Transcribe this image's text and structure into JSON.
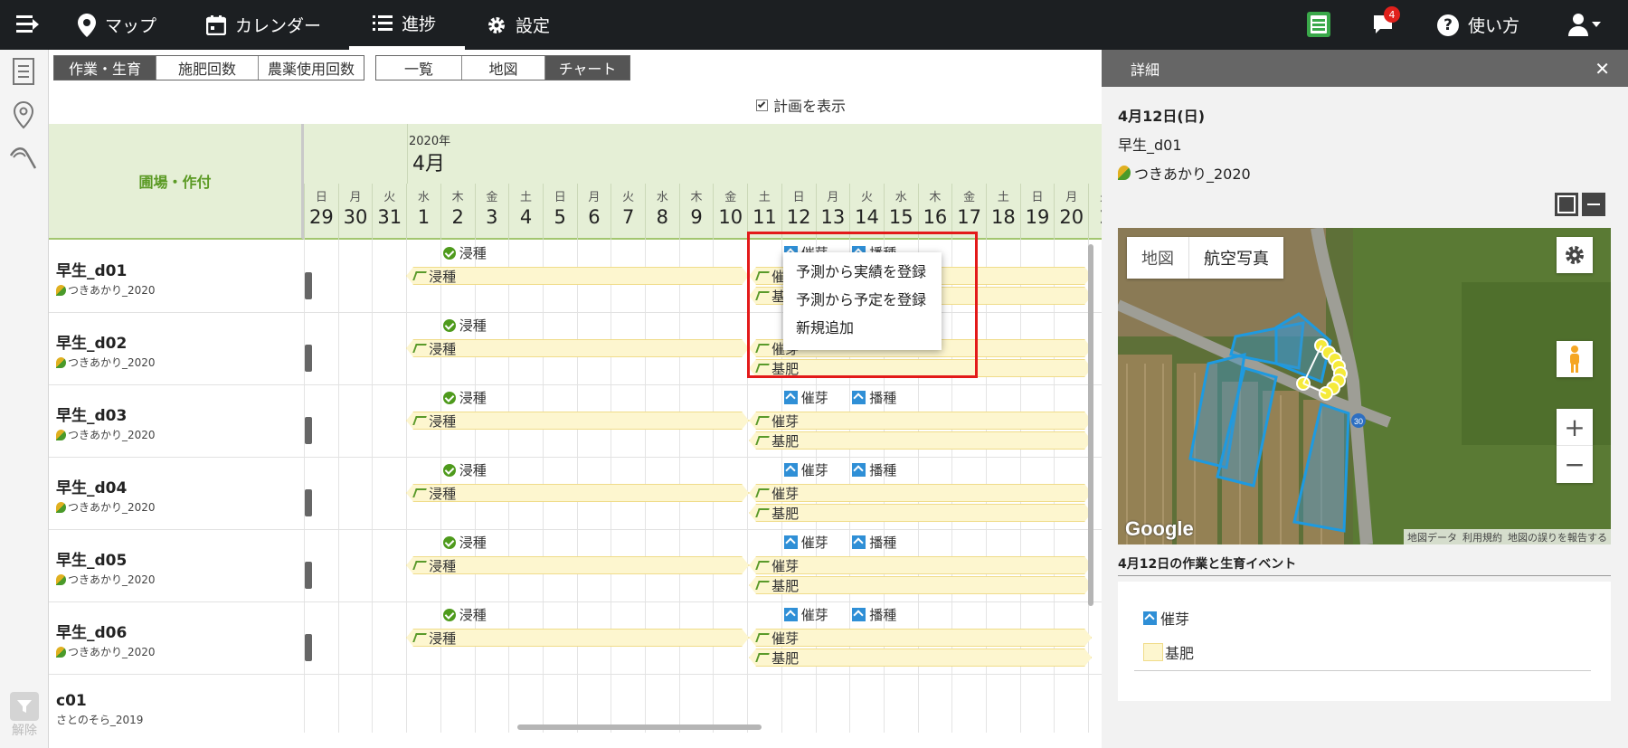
{
  "nav": {
    "items": [
      {
        "label": "マップ",
        "icon": "map-pin-icon"
      },
      {
        "label": "カレンダー",
        "icon": "calendar-icon"
      },
      {
        "label": "進捗",
        "icon": "list-icon"
      },
      {
        "label": "設定",
        "icon": "gear-icon"
      }
    ],
    "notification_count": "4",
    "help_label": "使い方"
  },
  "sidebar": {
    "filter_label": "解除"
  },
  "toolbar": {
    "group1": [
      "作業・生育",
      "施肥回数",
      "農薬使用回数"
    ],
    "group2": [
      "一覧",
      "地図",
      "チャート"
    ],
    "show_plan_label": "計画を表示"
  },
  "chart": {
    "field_header": "圃場・作付",
    "year": "2020年",
    "month": "4月",
    "days": [
      {
        "w": "日",
        "d": "29"
      },
      {
        "w": "月",
        "d": "30"
      },
      {
        "w": "火",
        "d": "31"
      },
      {
        "w": "水",
        "d": "1"
      },
      {
        "w": "木",
        "d": "2"
      },
      {
        "w": "金",
        "d": "3"
      },
      {
        "w": "土",
        "d": "4"
      },
      {
        "w": "日",
        "d": "5"
      },
      {
        "w": "月",
        "d": "6"
      },
      {
        "w": "火",
        "d": "7"
      },
      {
        "w": "水",
        "d": "8"
      },
      {
        "w": "木",
        "d": "9"
      },
      {
        "w": "金",
        "d": "10"
      },
      {
        "w": "土",
        "d": "11"
      },
      {
        "w": "日",
        "d": "12"
      },
      {
        "w": "月",
        "d": "13"
      },
      {
        "w": "火",
        "d": "14"
      },
      {
        "w": "水",
        "d": "15"
      },
      {
        "w": "木",
        "d": "16"
      },
      {
        "w": "金",
        "d": "17"
      },
      {
        "w": "土",
        "d": "18"
      },
      {
        "w": "日",
        "d": "19"
      },
      {
        "w": "月",
        "d": "20"
      },
      {
        "w": "火",
        "d": "2"
      }
    ],
    "rows": [
      {
        "field": "早生_d01",
        "crop": "つきあかり_2020"
      },
      {
        "field": "早生_d02",
        "crop": "つきあかり_2020"
      },
      {
        "field": "早生_d03",
        "crop": "つきあかり_2020"
      },
      {
        "field": "早生_d04",
        "crop": "つきあかり_2020"
      },
      {
        "field": "早生_d05",
        "crop": "つきあかり_2020"
      },
      {
        "field": "早生_d06",
        "crop": "つきあかり_2020"
      },
      {
        "field": "c01",
        "crop": "さとのそら_2019"
      }
    ],
    "labels": {
      "soak": "浸種",
      "sprout": "催芽",
      "sow": "播種",
      "basal": "基肥"
    }
  },
  "context_menu": [
    "予測から実績を登録",
    "予測から予定を登録",
    "新規追加"
  ],
  "detail": {
    "title": "詳細",
    "date": "4月12日(日)",
    "field": "早生_d01",
    "crop": "つきあかり_2020",
    "map_tabs": [
      "地図",
      "航空写真"
    ],
    "road_label": "30",
    "map_footer": [
      "地図データ",
      "利用規約",
      "地図の誤りを報告する"
    ],
    "events_title": "4月12日の作業と生育イベント",
    "events": [
      "催芽",
      "基肥"
    ]
  }
}
